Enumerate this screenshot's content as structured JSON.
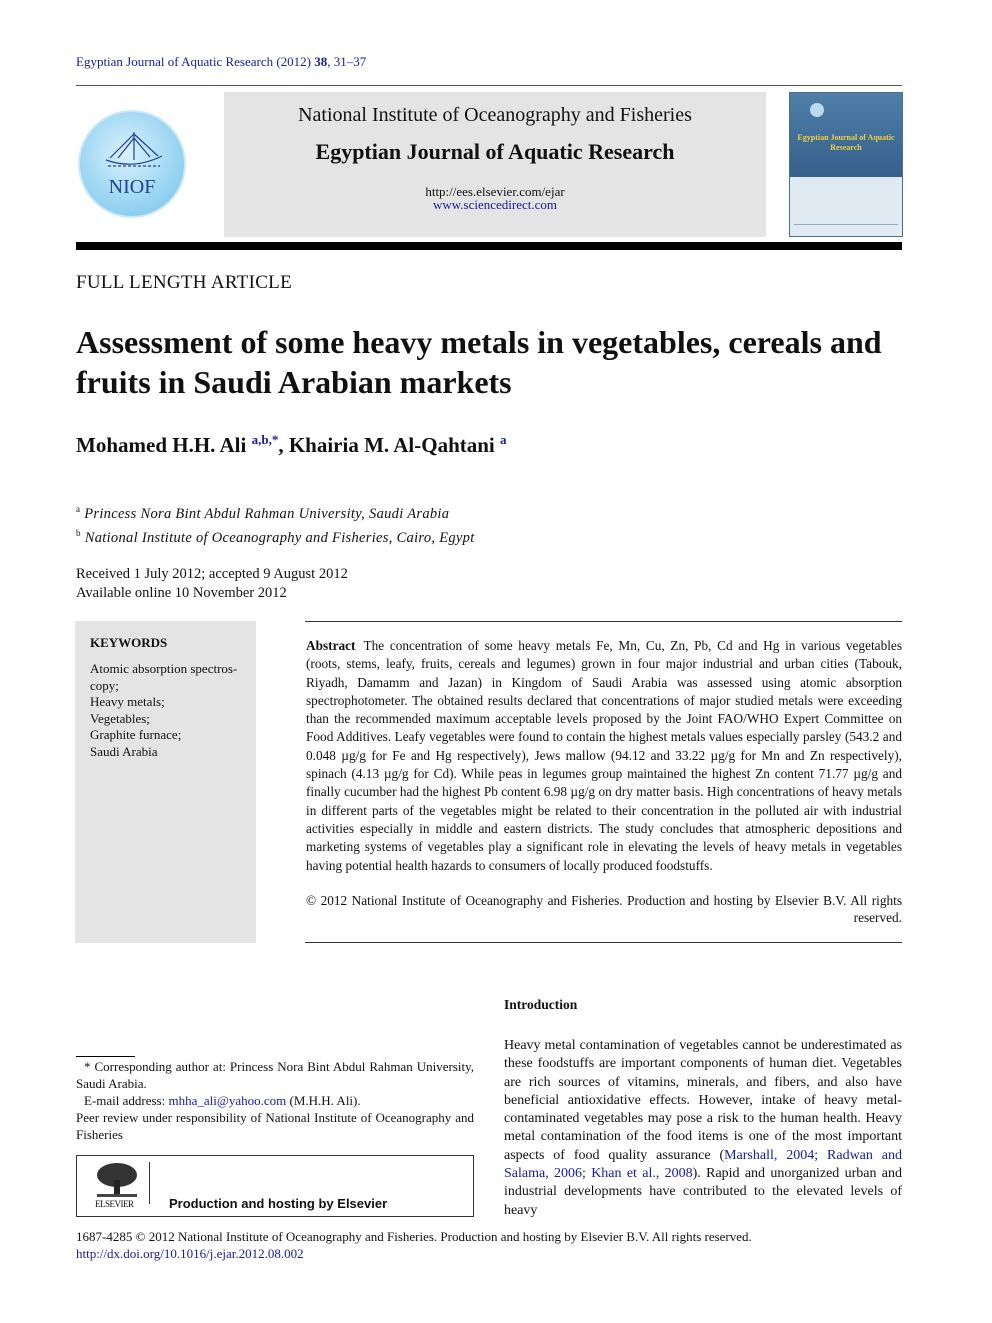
{
  "journal_ref": {
    "text": "Egyptian Journal of Aquatic Research (2012) ",
    "volume": "38",
    "pages": ", 31–37"
  },
  "header": {
    "logo_text": "NIOF",
    "institute": "National Institute of Oceanography and Fisheries",
    "journal_title": "Egyptian Journal of Aquatic Research",
    "url1": "http://ees.elsevier.com/ejar",
    "url2": "www.sciencedirect.com",
    "cover_title": "Egyptian Journal of Aquatic Research"
  },
  "article_type": "FULL LENGTH ARTICLE",
  "title": "Assessment of some heavy metals in vegetables, cereals and fruits in Saudi Arabian markets",
  "authors": [
    {
      "name": "Mohamed H.H. Ali ",
      "sup": "a,b,*"
    },
    {
      "name": ", Khairia M. Al-Qahtani ",
      "sup": "a"
    }
  ],
  "affiliations": [
    {
      "mark": "a",
      "text": "Princess Nora Bint Abdul Rahman University, Saudi Arabia"
    },
    {
      "mark": "b",
      "text": "National Institute of Oceanography and Fisheries, Cairo, Egypt"
    }
  ],
  "dates": {
    "received": "Received 1 July 2012; accepted 9 August 2012",
    "online": "Available online 10 November 2012"
  },
  "keywords": {
    "heading": "KEYWORDS",
    "items": [
      "Atomic absorption spectros-copy;",
      "Heavy metals;",
      "Vegetables;",
      "Graphite furnace;",
      "Saudi Arabia"
    ]
  },
  "abstract": {
    "label": "Abstract",
    "text": "The concentration of some heavy metals Fe, Mn, Cu, Zn, Pb, Cd and Hg in various vegetables (roots, stems, leafy, fruits, cereals and legumes) grown in four major industrial and urban cities (Tabouk, Riyadh, Damamm and Jazan) in Kingdom of Saudi Arabia was assessed using atomic absorption spectrophotometer. The obtained results declared that concentrations of major studied metals were exceeding than the recommended maximum acceptable levels proposed by the Joint FAO/WHO Expert Committee on Food Additives. Leafy vegetables were found to contain the highest metals values especially parsley (543.2 and 0.048 µg/g for Fe and Hg respectively), Jews mallow (94.12 and 33.22 µg/g for Mn and Zn respectively), spinach (4.13 µg/g for Cd). While peas in legumes group maintained the highest Zn content 71.77 µg/g and finally cucumber had the highest Pb content 6.98 µg/g on dry matter basis. High concentrations of heavy metals in different parts of the vegetables might be related to their concentration in the polluted air with industrial activities especially in middle and eastern districts. The study concludes that atmospheric depositions and marketing systems of vegetables play a significant role in elevating the levels of heavy metals in vegetables having potential health hazards to consumers of locally produced foodstuffs.",
    "copyright": "© 2012 National Institute of Oceanography and Fisheries. Production and hosting by Elsevier B.V. All rights reserved."
  },
  "footnotes": {
    "corresponding": "* Corresponding author at: Princess Nora Bint Abdul Rahman University, Saudi Arabia.",
    "email_label": "E-mail address: ",
    "email": "mhha_ali@yahoo.com",
    "email_suffix": " (M.H.H. Ali).",
    "peer_review": "Peer review under responsibility of National Institute of Oceanography and Fisheries"
  },
  "elsevier_box": {
    "logo_text": "ELSEVIER",
    "label": "Production and hosting by Elsevier"
  },
  "introduction": {
    "heading": "Introduction",
    "text_before": "Heavy metal contamination of vegetables cannot be underestimated as these foodstuffs are important components of human diet. Vegetables are rich sources of vitamins, minerals, and fibers, and also have beneficial antioxidative effects. However, intake of heavy metal-contaminated vegetables may pose a risk to the human health. Heavy metal contamination of the food items is one of the most important aspects of food quality assurance (",
    "citations": "Marshall, 2004; Radwan and Salama, 2006; Khan et al., 2008",
    "text_after": "). Rapid and unorganized urban and industrial developments have contributed to the elevated levels of heavy"
  },
  "bottom": {
    "issn": "1687-4285 © 2012 National Institute of Oceanography and Fisheries. Production and hosting by Elsevier B.V. All rights reserved.",
    "doi": "http://dx.doi.org/10.1016/j.ejar.2012.08.002"
  }
}
